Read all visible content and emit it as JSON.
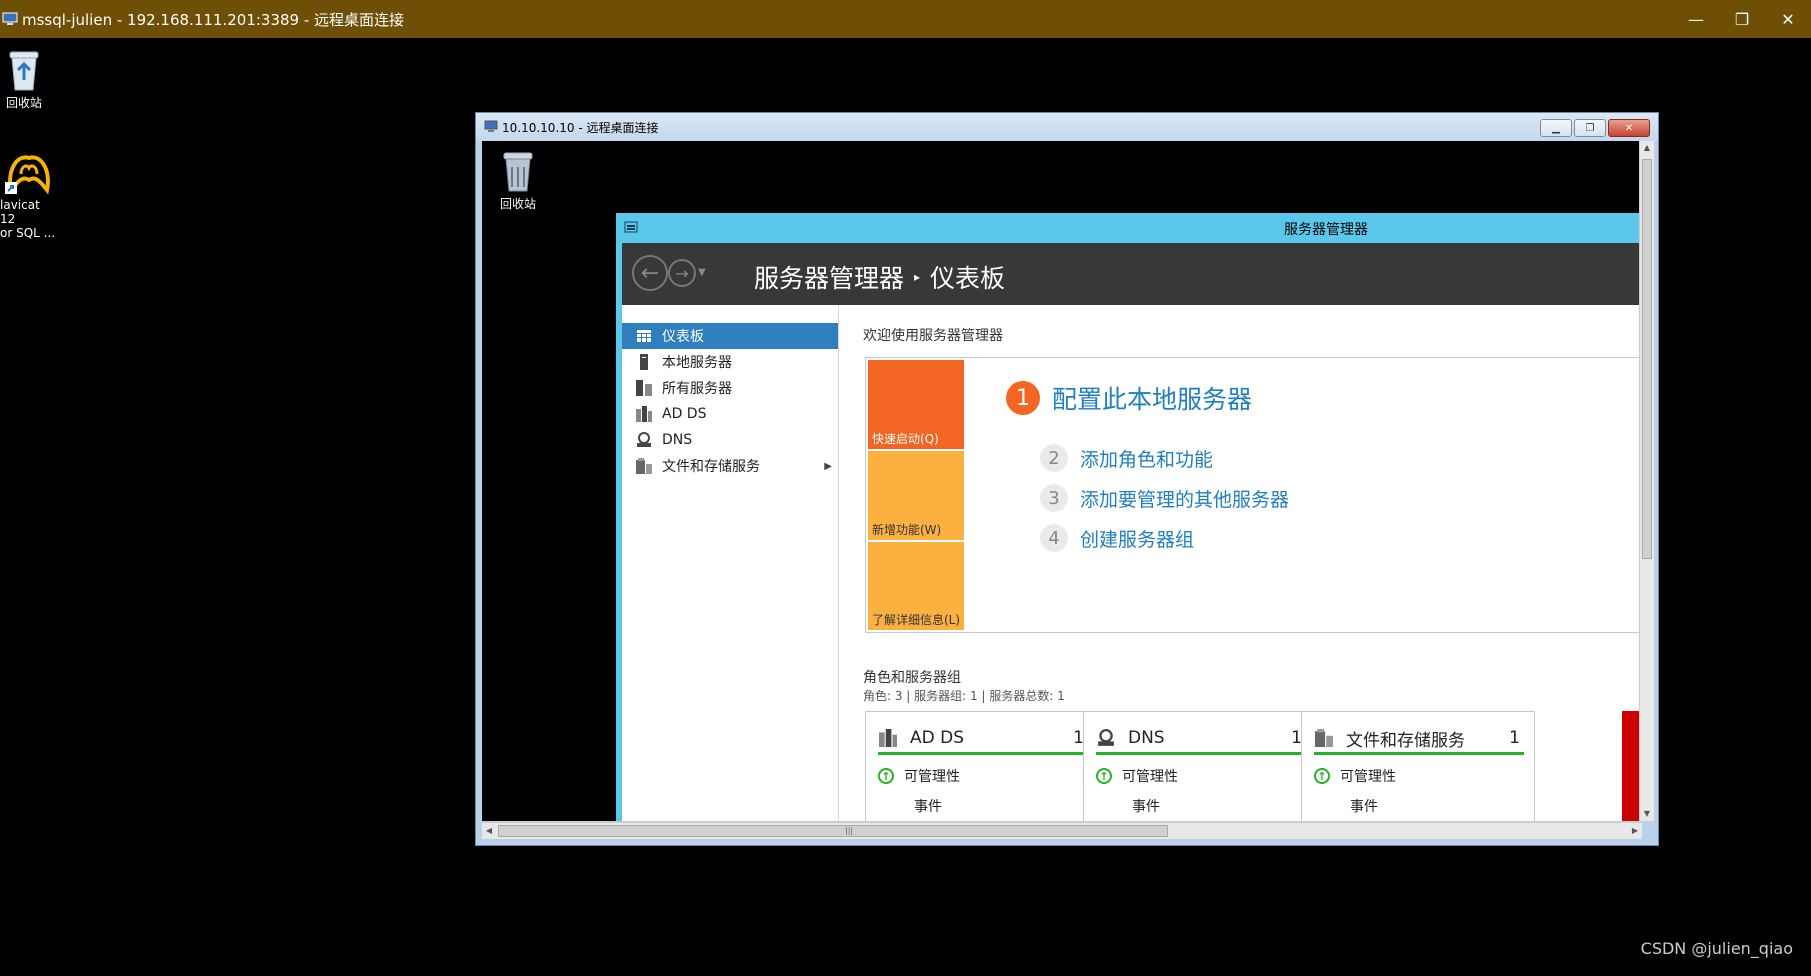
{
  "outer_window": {
    "title": "mssql-julien - 192.168.111.201:3389 - 远程桌面连接",
    "controls": [
      "—",
      "❐",
      "✕"
    ]
  },
  "desktop_icons": [
    {
      "label": "回收站"
    },
    {
      "label_line1": "lavicat 12",
      "label_line2": "or SQL ..."
    }
  ],
  "inner_window": {
    "title": "10.10.10.10 - 远程桌面连接",
    "desktop_icon_label": "回收站"
  },
  "server_manager": {
    "window_title": "服务器管理器",
    "breadcrumb": {
      "root": "服务器管理器",
      "separator": "▸",
      "current": "仪表板"
    },
    "sidebar": [
      {
        "label": "仪表板",
        "icon": "dashboard-icon",
        "selected": true
      },
      {
        "label": "本地服务器",
        "icon": "server-icon"
      },
      {
        "label": "所有服务器",
        "icon": "servers-icon"
      },
      {
        "label": "AD DS",
        "icon": "adds-icon"
      },
      {
        "label": "DNS",
        "icon": "dns-icon"
      },
      {
        "label": "文件和存储服务",
        "icon": "file-storage-icon",
        "has_submenu": true
      }
    ],
    "welcome": "欢迎使用服务器管理器",
    "tiles": [
      "快速启动(Q)",
      "新增功能(W)",
      "了解详细信息(L)"
    ],
    "steps": [
      {
        "num": "1",
        "label": "配置此本地服务器"
      },
      {
        "num": "2",
        "label": "添加角色和功能"
      },
      {
        "num": "3",
        "label": "添加要管理的其他服务器"
      },
      {
        "num": "4",
        "label": "创建服务器组"
      }
    ],
    "roles_title": "角色和服务器组",
    "roles_summary": "角色: 3 | 服务器组: 1 | 服务器总数: 1",
    "cards": [
      {
        "name": "AD DS",
        "count": "1",
        "manageability": "可管理性",
        "events": "事件"
      },
      {
        "name": "DNS",
        "count": "1",
        "manageability": "可管理性",
        "events": "事件"
      },
      {
        "name": "文件和存储服务",
        "count": "1",
        "manageability": "可管理性",
        "events": "事件"
      }
    ],
    "colors": {
      "accent": "#5ac8eb",
      "selected": "#2f7fbf",
      "tile_primary": "#f26522",
      "tile_secondary": "#fbb040",
      "status_ok": "#22b422"
    }
  },
  "watermark": "CSDN @julien_qiao"
}
